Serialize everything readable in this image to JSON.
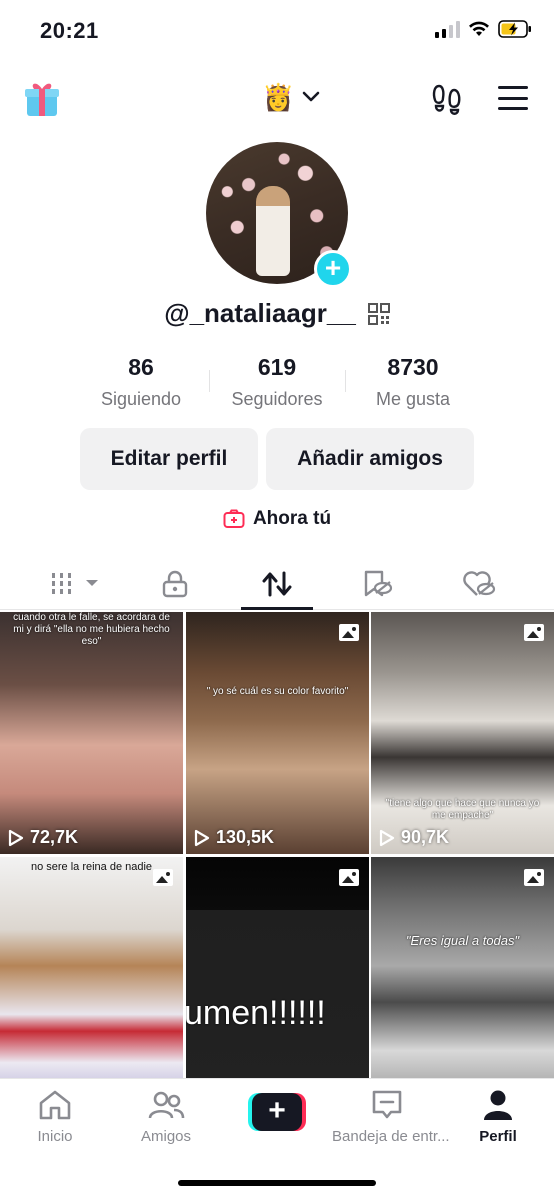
{
  "status_bar": {
    "time": "20:21"
  },
  "top_nav": {
    "account_emoji": "👸"
  },
  "profile": {
    "username": "@_nataliaagr__",
    "stats": [
      {
        "value": "86",
        "label": "Siguiendo"
      },
      {
        "value": "619",
        "label": "Seguidores"
      },
      {
        "value": "8730",
        "label": "Me gusta"
      }
    ],
    "edit_button": "Editar perfil",
    "add_friends_button": "Añadir amigos",
    "now_you": "Ahora tú"
  },
  "grid": {
    "items": [
      {
        "text": "cuando otra le falle, se acordara de mi y dirá \"ella no me hubiera hecho eso\"",
        "views": "72,7K",
        "type": "video"
      },
      {
        "text": "\" yo sé cuál es su color favorito\"",
        "views": "130,5K",
        "type": "photo"
      },
      {
        "text": "\"tiene algo que hace que nunca yo me empache\"",
        "views": "90,7K",
        "type": "photo"
      },
      {
        "text": "no sere la reina de nadie",
        "views": "",
        "type": "photo"
      },
      {
        "text": "umen!!!!!!",
        "views": "",
        "type": "photo"
      },
      {
        "text": "\"Eres igual a todas\"",
        "views": "",
        "type": "photo"
      }
    ]
  },
  "bottom_nav": {
    "items": [
      {
        "label": "Inicio",
        "icon": "home-icon"
      },
      {
        "label": "Amigos",
        "icon": "friends-icon"
      },
      {
        "label": "Bandeja de entr...",
        "icon": "inbox-icon"
      },
      {
        "label": "Perfil",
        "icon": "profile-icon"
      }
    ]
  },
  "colors": {
    "accent_cyan": "#20d5ec",
    "accent_pink": "#fe2c55",
    "text": "#161823"
  }
}
